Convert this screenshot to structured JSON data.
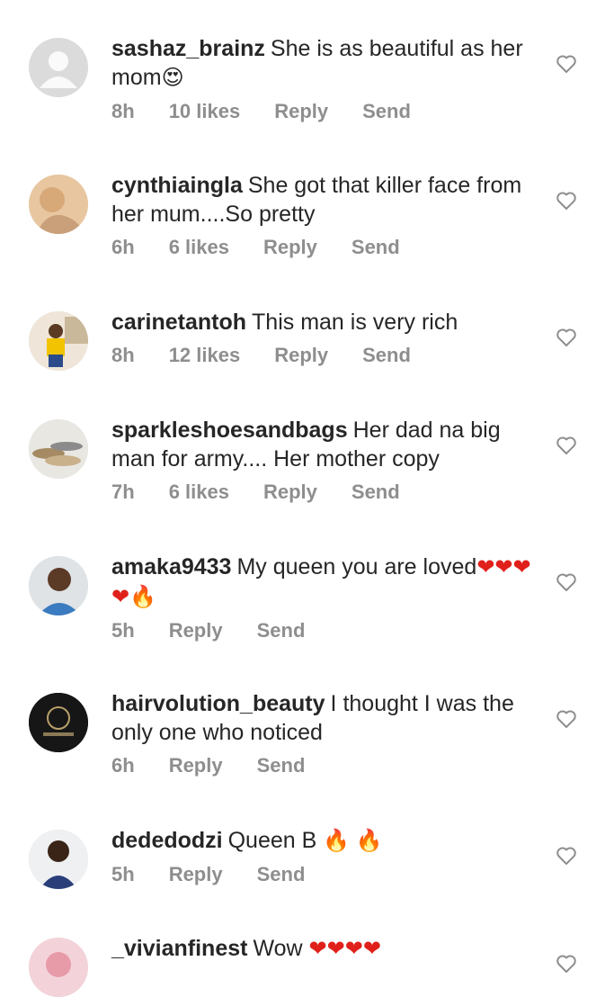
{
  "comments": [
    {
      "username": "sashaz_brainz",
      "text": "She is as beautiful as her mom",
      "emoji": "😍",
      "time": "8h",
      "likes": "10 likes",
      "reply": "Reply",
      "send": "Send"
    },
    {
      "username": "cynthiaingla",
      "text": "She got that killer face from her mum....So pretty",
      "emoji": "",
      "time": "6h",
      "likes": "6 likes",
      "reply": "Reply",
      "send": "Send"
    },
    {
      "username": "carinetantoh",
      "text": "This man is very rich",
      "emoji": "",
      "time": "8h",
      "likes": "12 likes",
      "reply": "Reply",
      "send": "Send"
    },
    {
      "username": "sparkleshoesandbags",
      "text": "Her dad na big man for army.... Her mother copy",
      "emoji": "",
      "time": "7h",
      "likes": "6 likes",
      "reply": "Reply",
      "send": "Send"
    },
    {
      "username": "amaka9433",
      "text": "My queen you are loved",
      "emoji": "❤❤❤❤🔥",
      "time": "5h",
      "likes": "",
      "reply": "Reply",
      "send": "Send"
    },
    {
      "username": "hairvolution_beauty",
      "text": "I thought I was the only one who noticed",
      "emoji": "",
      "time": "6h",
      "likes": "",
      "reply": "Reply",
      "send": "Send"
    },
    {
      "username": "dededodzi",
      "text": "Queen B",
      "emoji": "🔥 🔥",
      "time": "5h",
      "likes": "",
      "reply": "Reply",
      "send": "Send"
    },
    {
      "username": "_vivianfinest",
      "text": "Wow",
      "emoji": "❤❤❤❤",
      "time": "",
      "likes": "",
      "reply": "",
      "send": ""
    }
  ]
}
